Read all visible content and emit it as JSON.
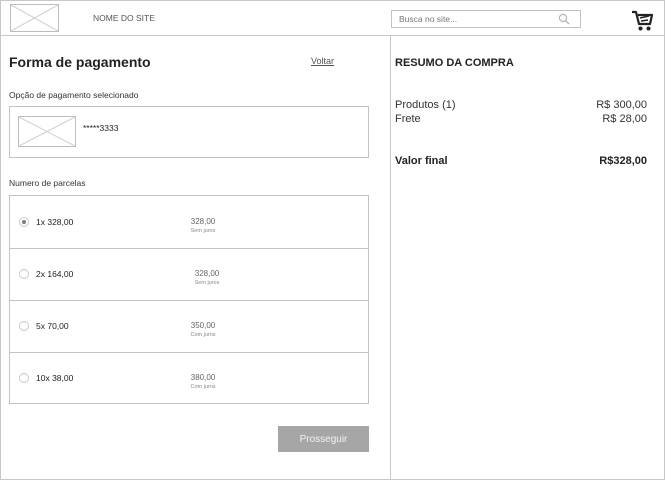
{
  "header": {
    "site_name": "NOME DO SITE",
    "search_placeholder": "Busca no site..."
  },
  "payment": {
    "title": "Forma de pagamento",
    "back_label": "Voltar",
    "selected_option_label": "Opção de pagamento selecionado",
    "card_number": "*****3333",
    "installments_label": "Numero de parcelas",
    "installments": [
      {
        "label": "1x  328,00",
        "total": "328,00",
        "note": "Sem juros",
        "selected": true
      },
      {
        "label": "2x 164,00",
        "total": "328,00",
        "note": "Sem juros",
        "selected": false
      },
      {
        "label": "5x 70,00",
        "total": "350,00",
        "note": "Com juros",
        "selected": false
      },
      {
        "label": "10x 38,00",
        "total": "380,00",
        "note": "Com juros",
        "selected": false
      }
    ],
    "submit_label": "Prosseguir"
  },
  "summary": {
    "title": "RESUMO DA COMPRA",
    "products_label": "Produtos (1)",
    "products_value": "R$ 300,00",
    "shipping_label": "Frete",
    "shipping_value": "R$ 28,00",
    "total_label": "Valor final",
    "total_value": "R$328,00"
  },
  "icons": {
    "logo": "image-placeholder-icon",
    "search": "search-icon",
    "cart": "cart-icon",
    "card": "image-placeholder-icon"
  }
}
